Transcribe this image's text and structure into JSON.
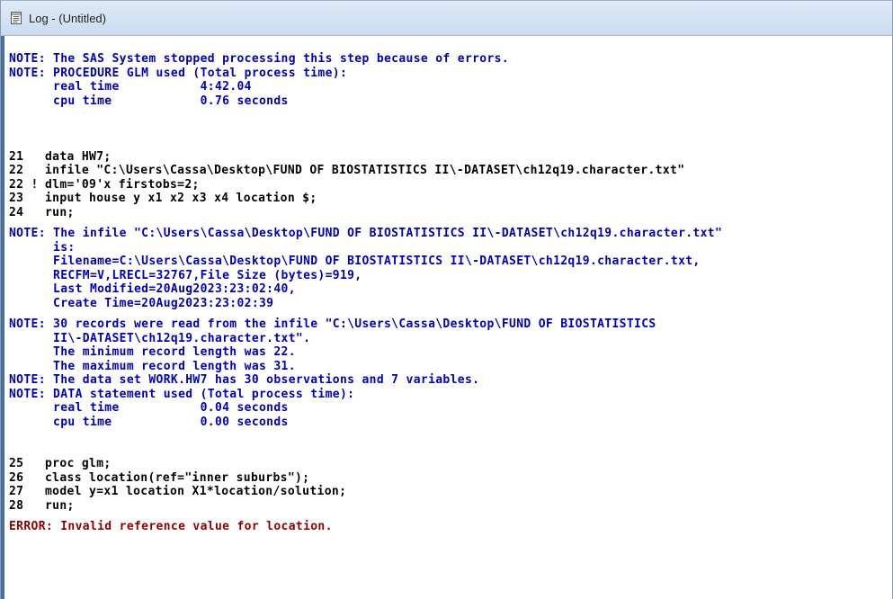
{
  "window": {
    "title": "Log - (Untitled)",
    "title_icon": "document-lines-icon"
  },
  "colors": {
    "note": "#0000b4",
    "error": "#8b0000",
    "source": "#000000",
    "title_bar": "#cbdcef"
  },
  "log": [
    {
      "kind": "note",
      "text": "NOTE: The SAS System stopped processing this step because of errors."
    },
    {
      "kind": "note",
      "text": "NOTE: PROCEDURE GLM used (Total process time):"
    },
    {
      "kind": "note",
      "text": "      real time           4:42.04"
    },
    {
      "kind": "note",
      "text": "      cpu time            0.76 seconds"
    },
    {
      "kind": "blank"
    },
    {
      "kind": "blank"
    },
    {
      "kind": "blank"
    },
    {
      "kind": "source",
      "num": "21",
      "text": "data HW7;"
    },
    {
      "kind": "source",
      "num": "22",
      "text": "infile \"C:\\Users\\Cassa\\Desktop\\FUND OF BIOSTATISTICS II\\-DATASET\\ch12q19.character.txt\""
    },
    {
      "kind": "source",
      "num": "22 !",
      "text": "dlm='09'x firstobs=2;"
    },
    {
      "kind": "source",
      "num": "23",
      "text": "input house y x1 x2 x3 x4 location $;"
    },
    {
      "kind": "source",
      "num": "24",
      "text": "run;"
    },
    {
      "kind": "gap"
    },
    {
      "kind": "note",
      "text": "NOTE: The infile \"C:\\Users\\Cassa\\Desktop\\FUND OF BIOSTATISTICS II\\-DATASET\\ch12q19.character.txt\""
    },
    {
      "kind": "note",
      "text": "      is:"
    },
    {
      "kind": "note",
      "text": "      Filename=C:\\Users\\Cassa\\Desktop\\FUND OF BIOSTATISTICS II\\-DATASET\\ch12q19.character.txt,"
    },
    {
      "kind": "note",
      "text": "      RECFM=V,LRECL=32767,File Size (bytes)=919,"
    },
    {
      "kind": "note",
      "text": "      Last Modified=20Aug2023:23:02:40,"
    },
    {
      "kind": "note",
      "text": "      Create Time=20Aug2023:23:02:39"
    },
    {
      "kind": "gap"
    },
    {
      "kind": "note",
      "text": "NOTE: 30 records were read from the infile \"C:\\Users\\Cassa\\Desktop\\FUND OF BIOSTATISTICS"
    },
    {
      "kind": "note",
      "text": "      II\\-DATASET\\ch12q19.character.txt\"."
    },
    {
      "kind": "note",
      "text": "      The minimum record length was 22."
    },
    {
      "kind": "note",
      "text": "      The maximum record length was 31."
    },
    {
      "kind": "note",
      "text": "NOTE: The data set WORK.HW7 has 30 observations and 7 variables."
    },
    {
      "kind": "note",
      "text": "NOTE: DATA statement used (Total process time):"
    },
    {
      "kind": "note",
      "text": "      real time           0.04 seconds"
    },
    {
      "kind": "note",
      "text": "      cpu time            0.00 seconds"
    },
    {
      "kind": "blank"
    },
    {
      "kind": "blank"
    },
    {
      "kind": "source",
      "num": "25",
      "text": "proc glm;"
    },
    {
      "kind": "source",
      "num": "26",
      "text": "class location(ref=\"inner suburbs\");"
    },
    {
      "kind": "source",
      "num": "27",
      "text": "model y=x1 location X1*location/solution;"
    },
    {
      "kind": "source",
      "num": "28",
      "text": "run;"
    },
    {
      "kind": "gap"
    },
    {
      "kind": "error",
      "text": "ERROR: Invalid reference value for location."
    }
  ]
}
